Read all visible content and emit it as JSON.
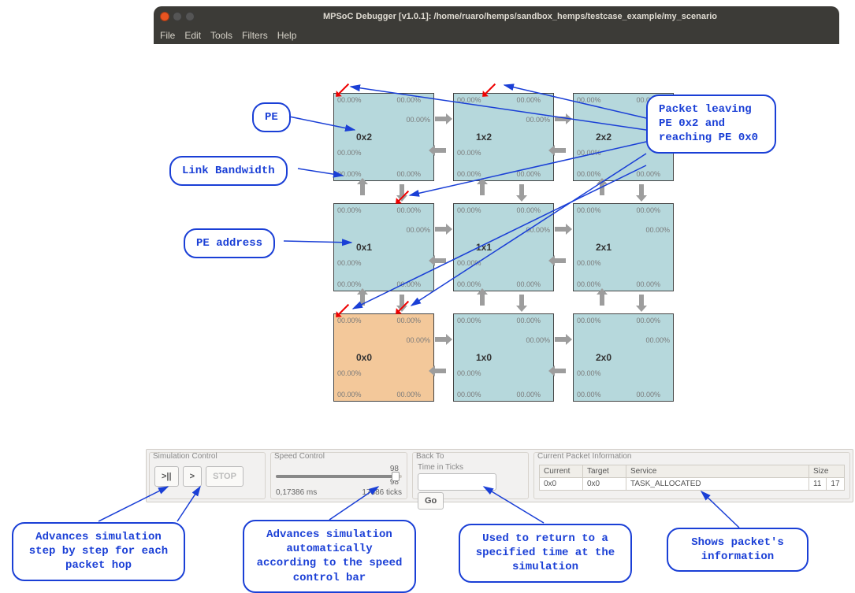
{
  "window": {
    "title": "MPSoC Debugger [v1.0.1]: /home/ruaro/hemps/sandbox_hemps/testcase_example/my_scenario"
  },
  "menubar": {
    "file": "File",
    "edit": "Edit",
    "tools": "Tools",
    "filters": "Filters",
    "help": "Help"
  },
  "noc": {
    "link_pct": "00.00%",
    "cells": {
      "r0c0": "0x2",
      "r0c1": "1x2",
      "r0c2": "2x2",
      "r1c0": "0x1",
      "r1c1": "1x1",
      "r1c2": "2x1",
      "r2c0": "0x0",
      "r2c1": "1x0",
      "r2c2": "2x0"
    }
  },
  "controls": {
    "sim": {
      "label": "Simulation Control",
      "step": ">||",
      "play": ">",
      "stop": "STOP"
    },
    "speed": {
      "label": "Speed Control",
      "top_val": "98",
      "slider_val": "98",
      "time_ms": "0,17386 ms",
      "ticks": "17386 ticks"
    },
    "back": {
      "label": "Back To",
      "sub": "Time in Ticks",
      "go": "Go"
    },
    "packet": {
      "label": "Current Packet Information",
      "h_current": "Current",
      "h_target": "Target",
      "h_service": "Service",
      "h_size": "Size",
      "v_current": "0x0",
      "v_target": "0x0",
      "v_service": "TASK_ALLOCATED",
      "v_size1": "11",
      "v_size2": "17"
    }
  },
  "callouts": {
    "pe": "PE",
    "link_bw": "Link Bandwidth",
    "pe_addr": "PE address",
    "packet_leaving": "Packet leaving PE 0x2 and reaching PE 0x0",
    "adv_step": "Advances simulation step by step for each packet hop",
    "adv_auto": "Advances simulation automatically according to the speed control bar",
    "back_to": "Used to return to a specified time at the simulation",
    "packet_info": "Shows packet's information"
  }
}
